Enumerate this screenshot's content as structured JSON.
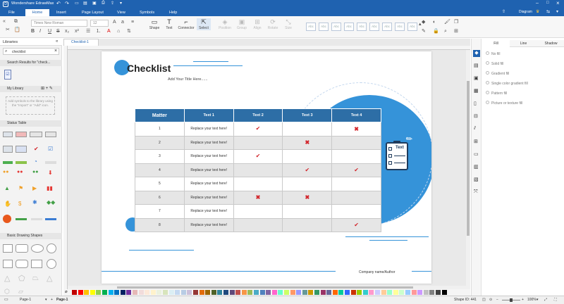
{
  "app": {
    "title": "Wondershare EdrawMax"
  },
  "tabs": [
    "File",
    "Home",
    "Insert",
    "Page Layout",
    "View",
    "Symbols",
    "Help"
  ],
  "topright": {
    "publish": "Publish",
    "diagram": "Diagram"
  },
  "ribbon": {
    "font_name": "Times New Roman",
    "font_size": "12",
    "buttons": [
      "Shape",
      "Text",
      "Connector",
      "Select"
    ],
    "dim_buttons": [
      "Position",
      "Group",
      "Align",
      "Rotate",
      "Size"
    ],
    "style_labels": [
      "Abc",
      "Abc",
      "Abc",
      "Abc",
      "Abc",
      "Abc",
      "Abc",
      "Abc",
      "Abc"
    ]
  },
  "doc_tab": "Checklist-1",
  "left": {
    "title": "Libraries",
    "search_value": "checklist",
    "search_results": "Search Results for \"check...",
    "my_library": "My Library",
    "lib_hint": "Add symbols to the library using the \"Import\" or \"Add\" icon.",
    "status_table": "Status Table",
    "basic_shapes": "Basic Drawing Shapes"
  },
  "page": {
    "title": "Checklist",
    "subtitle": "Add Your Title Here......",
    "footer": "Company name/Author",
    "clipboard_text": "Text",
    "table": {
      "headers": [
        "Matter",
        "Text 1",
        "Text 2",
        "Text 3",
        "Text 4"
      ],
      "rows": [
        {
          "n": "1",
          "t1": "Replace your text here!",
          "c2": "check",
          "c3": "",
          "c4": "x"
        },
        {
          "n": "2",
          "t1": "Replace your text here!",
          "c2": "",
          "c3": "x",
          "c4": ""
        },
        {
          "n": "3",
          "t1": "Replace your text here!",
          "c2": "check",
          "c3": "",
          "c4": ""
        },
        {
          "n": "4",
          "t1": "Replace your text here!",
          "c2": "",
          "c3": "check",
          "c4": "check"
        },
        {
          "n": "5",
          "t1": "Replace your text here!",
          "c2": "",
          "c3": "",
          "c4": ""
        },
        {
          "n": "6",
          "t1": "Replace your text here!",
          "c2": "x",
          "c3": "x",
          "c4": ""
        },
        {
          "n": "7",
          "t1": "Replace your text here!",
          "c2": "",
          "c3": "",
          "c4": ""
        },
        {
          "n": "8",
          "t1": "Replace your text here!",
          "c2": "",
          "c3": "",
          "c4": "check"
        }
      ]
    }
  },
  "right": {
    "tabs": [
      "Fill",
      "Line",
      "Shadow"
    ],
    "options": [
      "No fill",
      "Solid fill",
      "Gradient fill",
      "Single color gradient fill",
      "Pattern fill",
      "Picture or texture fill"
    ]
  },
  "status": {
    "page_select": "Page-1",
    "page_tab": "Page-1",
    "shape_id": "Shape ID: 441",
    "zoom": "100%"
  },
  "colors": {
    "accent": "#1f62b0",
    "table_header": "#2d6ea6",
    "circle": "#3593d9",
    "mark": "#d2262c"
  },
  "palette": [
    "#c00000",
    "#ff0000",
    "#ffc000",
    "#ffff00",
    "#92d050",
    "#00b050",
    "#00b0f0",
    "#0070c0",
    "#002060",
    "#7030a0",
    "#e6b8b7",
    "#f2dcdb",
    "#fde9d9",
    "#fff2cc",
    "#ebf1de",
    "#d8e4bc",
    "#dbeef4",
    "#c5d9f1",
    "#b8cce4",
    "#ccc0da",
    "#953735",
    "#e26b0a",
    "#9c6500",
    "#4f6228",
    "#31859c",
    "#1f497d",
    "#60497a",
    "#c0504d",
    "#f79646",
    "#9bbb59",
    "#4bacc6",
    "#4f81bd",
    "#8064a2",
    "#ff66cc",
    "#66ffcc",
    "#ccff66",
    "#ff9966",
    "#9999ff",
    "#669999",
    "#cc9900",
    "#339966",
    "#993366",
    "#666699",
    "#ff6600",
    "#00cc99",
    "#3366ff",
    "#cc3300",
    "#99cc00",
    "#33cccc",
    "#ff99cc",
    "#ccccff",
    "#ffcc99",
    "#99ffcc",
    "#ffff99",
    "#ccffcc",
    "#99ccff",
    "#ff9999",
    "#cc99ff",
    "#c0c0c0",
    "#808080",
    "#404040",
    "#000000"
  ]
}
